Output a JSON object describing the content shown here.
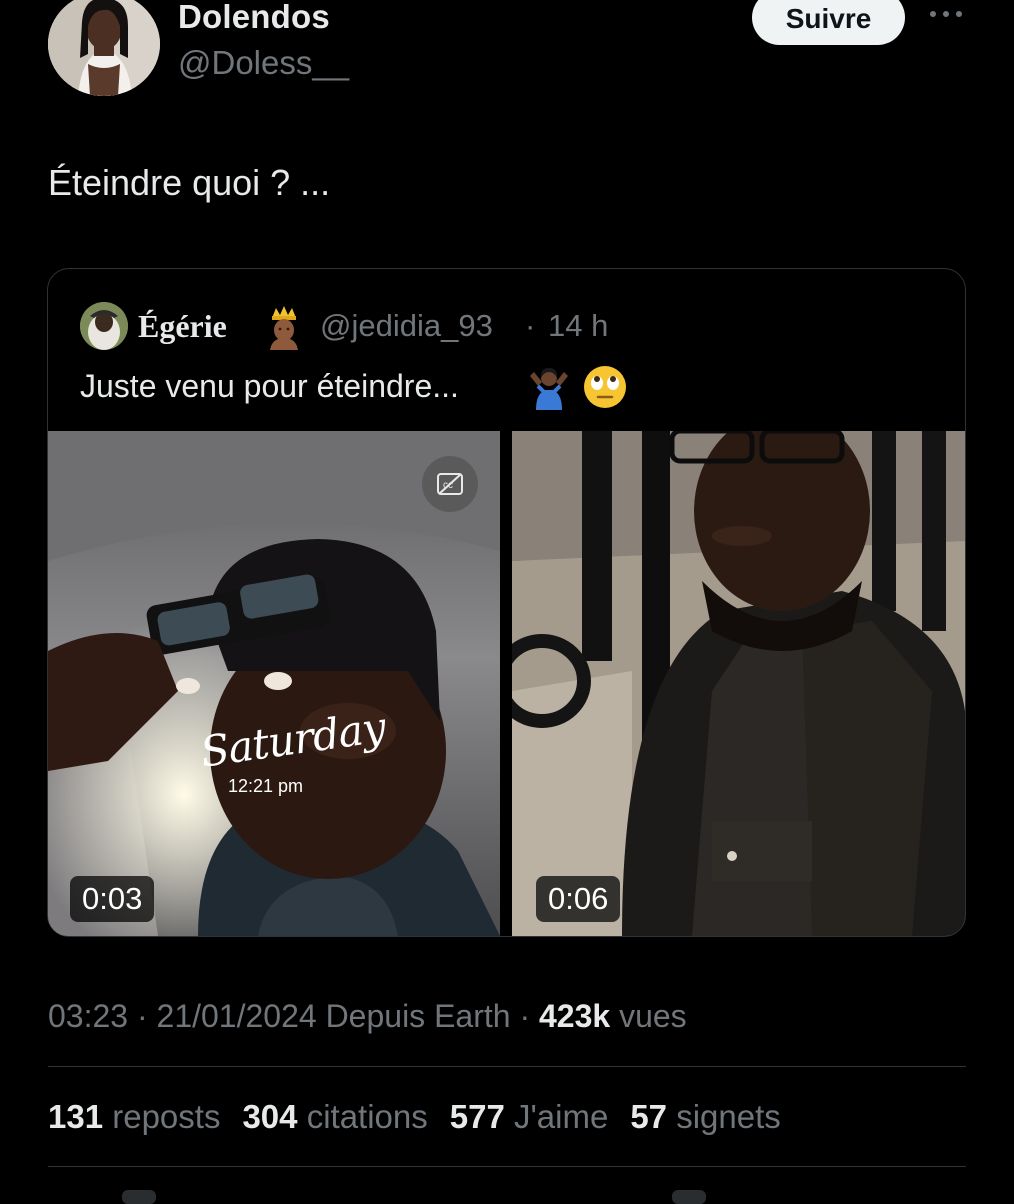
{
  "author": {
    "display_name": "Dolendos",
    "handle": "@Doless__",
    "follow_label": "Suivre",
    "more_icon": "more-horizontal-icon"
  },
  "tweet": {
    "text": "Éteindre quoi ? ..."
  },
  "quote": {
    "display_name": "Égérie",
    "badge_emoji": "crown-person-emoji",
    "handle": "@jedidia_93",
    "separator": "·",
    "time": "14 h",
    "text": "Juste venu pour éteindre...",
    "emojis": [
      "shrug-emoji",
      "eye-roll-emoji"
    ],
    "media": [
      {
        "duration": "0:03",
        "sticker_title": "Saturday",
        "sticker_time": "12:21 pm",
        "caption_badge": "cc-icon"
      },
      {
        "duration": "0:06"
      }
    ]
  },
  "meta": {
    "time": "03:23",
    "sep1": "·",
    "date": "21/01/2024",
    "source": "Depuis Earth",
    "sep2": "·",
    "views": "423k",
    "views_label": "vues"
  },
  "stats": [
    {
      "value": "131",
      "label": "reposts"
    },
    {
      "value": "304",
      "label": "citations"
    },
    {
      "value": "577",
      "label": "J'aime"
    },
    {
      "value": "57",
      "label": "signets"
    }
  ],
  "colors": {
    "background": "#000000",
    "text_primary": "#e7e9ea",
    "text_secondary": "#71767b",
    "border": "#2f3336",
    "button_bg": "#eff3f4"
  }
}
